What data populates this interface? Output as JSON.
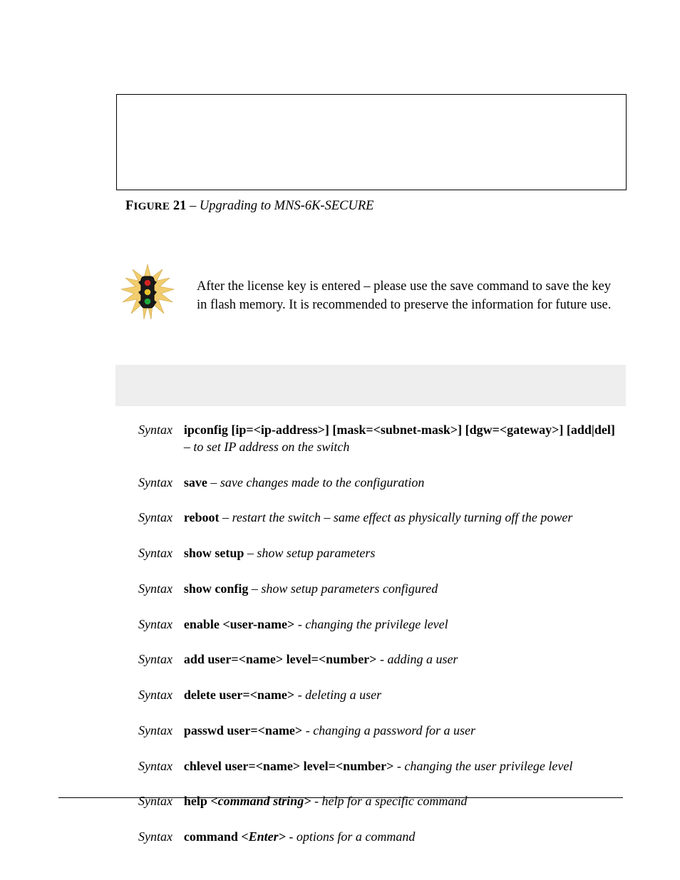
{
  "figure": {
    "label": "FIGURE",
    "num": "21",
    "sep": " – ",
    "title": "Upgrading to MNS-6K-SECURE"
  },
  "note": "After the license key is entered – please use the save command to save the key in flash memory. It is recommended to preserve the information for future use.",
  "syntax_label": "Syntax",
  "entries": [
    {
      "cmd": "ipconfig [ip=<ip-address>] [mask=<subnet-mask>] [dgw=<gateway>] [add|del]",
      "sep": " – ",
      "desc": "to set IP address on the switch",
      "wrap": true
    },
    {
      "cmd": "save",
      "sep": " – ",
      "desc": "save changes made to the configuration"
    },
    {
      "cmd": "reboot",
      "sep": " – ",
      "desc": "restart the switch – same effect as physically turning off the power"
    },
    {
      "cmd": "show setup",
      "sep": " – ",
      "desc": "show setup parameters"
    },
    {
      "cmd": "show config",
      "sep": " – ",
      "desc": "show setup parameters configured"
    },
    {
      "cmd": "enable <user-name>",
      "sep": " - ",
      "desc": "changing the privilege level"
    },
    {
      "cmd": "add user=<name> level=<number>",
      "sep": " - ",
      "desc": "adding a user"
    },
    {
      "cmd": "delete user=<name>",
      "sep": " - ",
      "desc": "deleting a user"
    },
    {
      "cmd": "passwd user=<name>",
      "sep": " - ",
      "desc": "changing a password for a user"
    },
    {
      "cmd": "chlevel user=<name> level=<number>",
      "sep": " - ",
      "desc": "changing the user privilege level"
    },
    {
      "cmd": "help ",
      "cmd_ital": "<command string>",
      "sep": " - ",
      "desc": "help for a specific command"
    },
    {
      "cmd": "command ",
      "cmd_ital": "<Enter>",
      "sep": " - ",
      "desc": "options for a command"
    }
  ]
}
